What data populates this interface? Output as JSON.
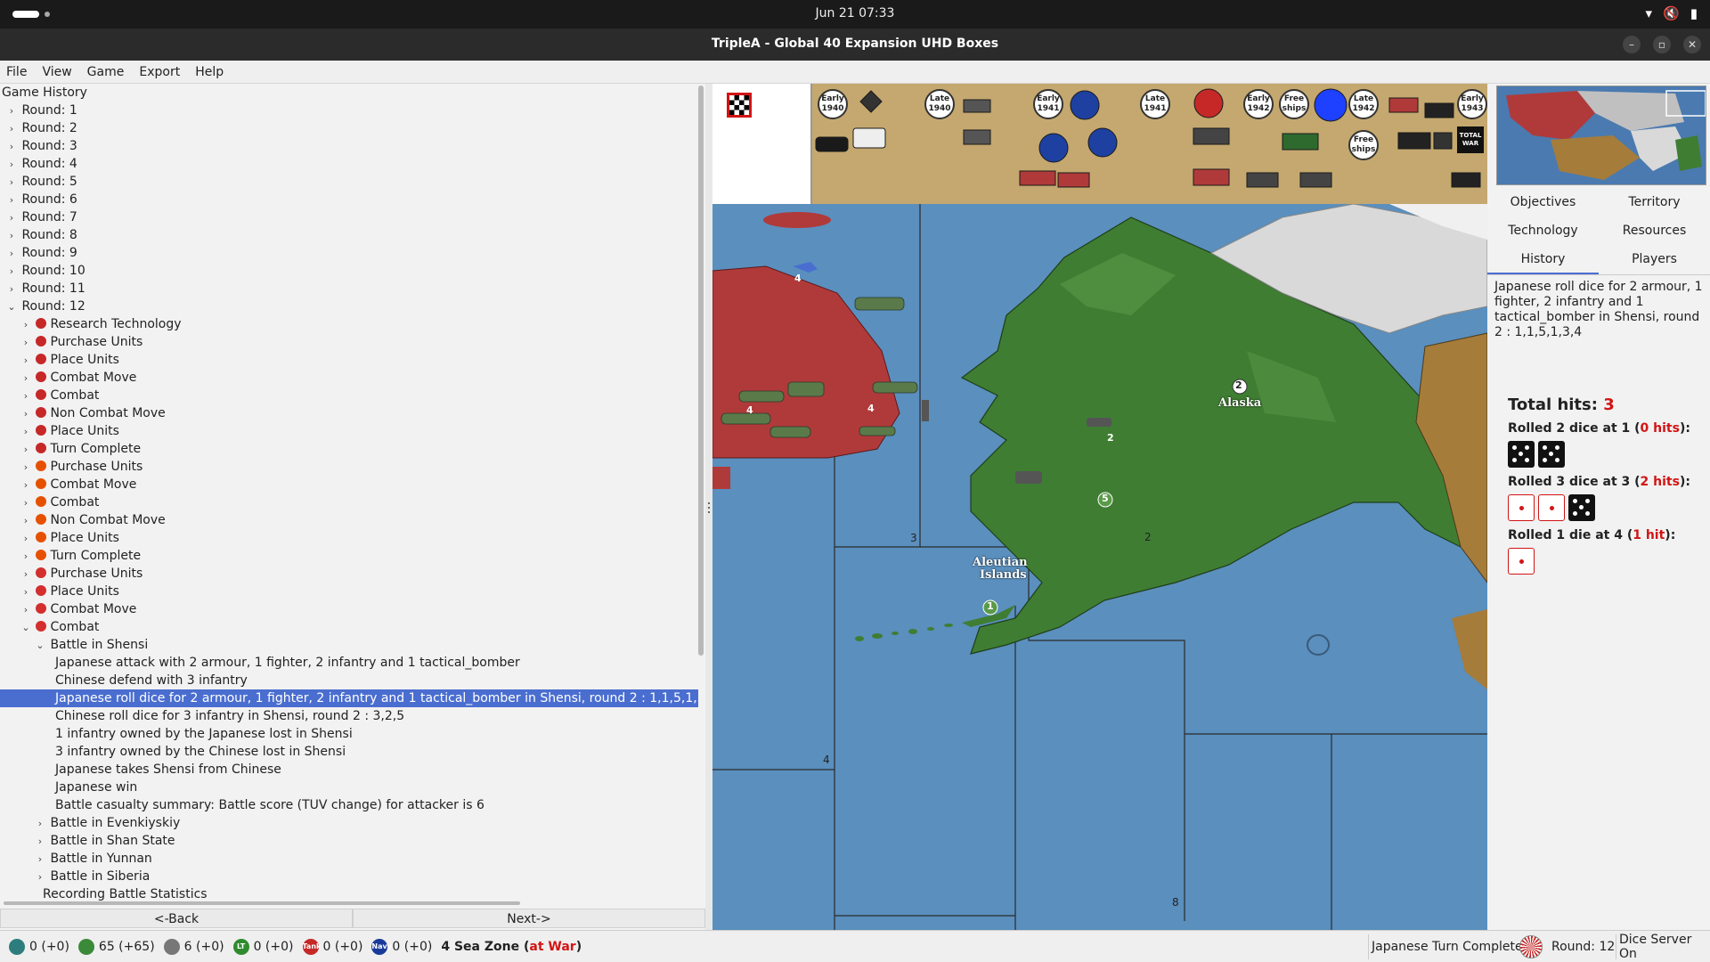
{
  "os": {
    "clock": "Jun 21  07:33"
  },
  "window": {
    "title": "TripleA - Global 40 Expansion UHD Boxes"
  },
  "menu": [
    "File",
    "View",
    "Game",
    "Export",
    "Help"
  ],
  "history": {
    "header": "Game History",
    "rounds": [
      "Round: 1",
      "Round: 2",
      "Round: 3",
      "Round: 4",
      "Round: 5",
      "Round: 6",
      "Round: 7",
      "Round: 8",
      "Round: 9",
      "Round: 10",
      "Round: 11"
    ],
    "round12": "Round: 12",
    "steps": [
      {
        "label": "Research Technology",
        "flag": "#c62828"
      },
      {
        "label": "Purchase Units",
        "flag": "#c62828"
      },
      {
        "label": "Place Units",
        "flag": "#c62828"
      },
      {
        "label": "Combat Move",
        "flag": "#c62828"
      },
      {
        "label": "Combat",
        "flag": "#c62828"
      },
      {
        "label": "Non Combat Move",
        "flag": "#c62828"
      },
      {
        "label": "Place Units",
        "flag": "#c62828"
      },
      {
        "label": "Turn Complete",
        "flag": "#c62828"
      },
      {
        "label": "Purchase Units",
        "flag": "#e65100"
      },
      {
        "label": "Combat Move",
        "flag": "#e65100"
      },
      {
        "label": "Combat",
        "flag": "#e65100"
      },
      {
        "label": "Non Combat Move",
        "flag": "#e65100"
      },
      {
        "label": "Place Units",
        "flag": "#e65100"
      },
      {
        "label": "Turn Complete",
        "flag": "#e65100"
      },
      {
        "label": "Purchase Units",
        "flag": "#d32f2f"
      },
      {
        "label": "Place Units",
        "flag": "#d32f2f"
      },
      {
        "label": "Combat Move",
        "flag": "#d32f2f"
      }
    ],
    "combat": "Combat",
    "battle": "Battle in Shensi",
    "battle_events": [
      "Japanese attack with 2 armour, 1 fighter, 2 infantry and 1 tactical_bomber",
      "Chinese defend with 3 infantry"
    ],
    "selected_event": "Japanese roll dice for 2 armour, 1 fighter, 2 infantry and 1 tactical_bomber in Shensi, round 2 : 1,1,5,1,3,4",
    "more_events": [
      "Chinese roll dice for 3 infantry in Shensi, round 2 : 3,2,5",
      "1 infantry owned by the Japanese lost in Shensi",
      "3 infantry owned by the Chinese lost in Shensi",
      "Japanese takes Shensi from Chinese",
      "Japanese win",
      "Battle casualty summary: Battle score (TUV change) for attacker is 6"
    ],
    "other_battles": [
      "Battle in Evenkiyskiy",
      "Battle in Shan State",
      "Battle in Yunnan",
      "Battle in Siberia"
    ],
    "last_item": "Recording Battle Statistics"
  },
  "nav": {
    "back": "<-Back",
    "next": "Next->"
  },
  "map": {
    "labels": {
      "alaska": "Alaska",
      "aleutian1": "Aleutian",
      "aleutian2": "Islands"
    },
    "zone_numbers": [
      "3",
      "2",
      "4",
      "8"
    ],
    "unit_counts": [
      "4",
      "4",
      "4",
      "2"
    ],
    "territory_values": [
      "2",
      "5",
      "1"
    ],
    "tech_badges": [
      {
        "l1": "Early",
        "l2": "1940"
      },
      {
        "l1": "Late",
        "l2": "1940"
      },
      {
        "l1": "Early",
        "l2": "1941"
      },
      {
        "l1": "Late",
        "l2": "1941"
      },
      {
        "l1": "Early",
        "l2": "1942"
      },
      {
        "l1": "Free",
        "l2": "ships"
      },
      {
        "l1": "Late",
        "l2": "1942"
      },
      {
        "l1": "Early",
        "l2": "1943"
      },
      {
        "l1": "Free",
        "l2": "ships"
      }
    ],
    "total_war_1": "TOTAL",
    "total_war_2": "WAR"
  },
  "sidebar": {
    "tabs_row1": [
      "Objectives",
      "Territory"
    ],
    "tabs_row2": [
      "Technology",
      "Resources"
    ],
    "tabs_row3": [
      "History",
      "Players"
    ],
    "history_text": "Japanese roll dice for 2 armour, 1 fighter, 2 infantry and 1 tactical_bomber in Shensi, round 2 : 1,1,5,1,3,4",
    "total_hits_label": "Total hits:",
    "total_hits_value": "3",
    "rolls": [
      {
        "prefix": "Rolled 2 dice at 1 (",
        "hits": "0 hits",
        "suffix": "):",
        "dice": [
          5,
          5
        ],
        "hitmask": [
          false,
          false
        ]
      },
      {
        "prefix": "Rolled 3 dice at 3 (",
        "hits": "2 hits",
        "suffix": "):",
        "dice": [
          1,
          1,
          5
        ],
        "hitmask": [
          true,
          true,
          false
        ]
      },
      {
        "prefix": "Rolled 1 die at 4 (",
        "hits": "1 hit",
        "suffix": "):",
        "dice": [
          1
        ],
        "hitmask": [
          true
        ]
      }
    ]
  },
  "status": {
    "resources": [
      {
        "icon": "tech-token-icon",
        "value": "0 (+0)",
        "color": "#2e7d7d"
      },
      {
        "icon": "pus-icon",
        "value": "65 (+65)",
        "color": "#3a8a3a"
      },
      {
        "icon": "skull-icon",
        "value": "6 (+0)",
        "color": "#777777"
      },
      {
        "icon": "land-tokens-icon",
        "value": "0 (+0)",
        "color": "#2e8b2e",
        "text": "LT"
      },
      {
        "icon": "tank-tokens-icon",
        "value": "0 (+0)",
        "color": "#c62828",
        "text": "Tank"
      },
      {
        "icon": "navy-tokens-icon",
        "value": "0 (+0)",
        "color": "#1a3a9a",
        "text": "Navy"
      }
    ],
    "zone": "4 Sea Zone",
    "zone_status": "at War",
    "step": "Japanese Turn Complete",
    "round": "Round: 12",
    "dice_server": "Dice Server On"
  }
}
